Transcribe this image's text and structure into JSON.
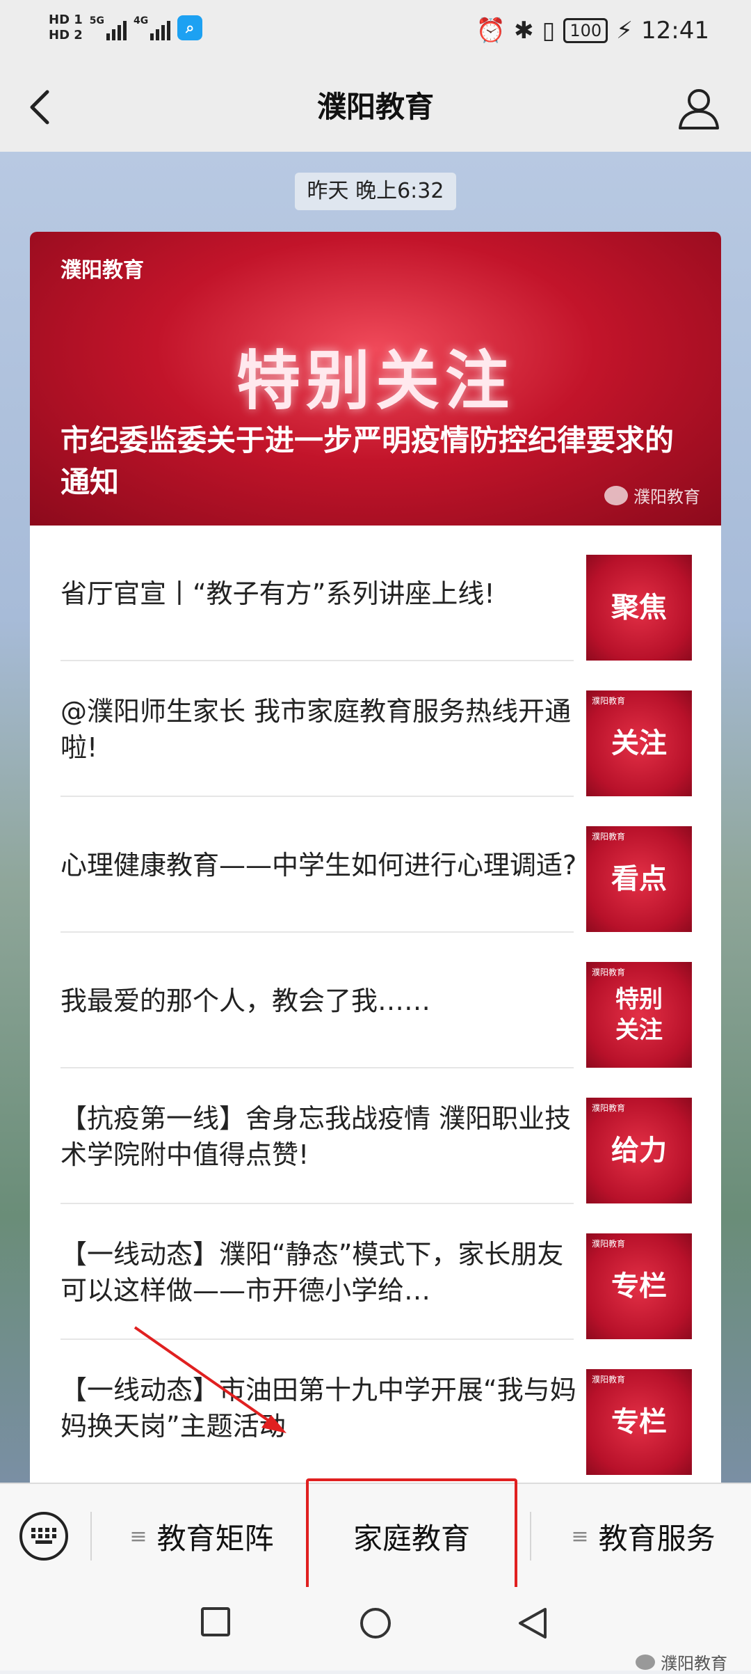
{
  "status_bar": {
    "hd1": "HD 1",
    "hd2": "HD 2",
    "net1": "5G",
    "net2": "4G",
    "battery": "100",
    "time": "12:41"
  },
  "nav": {
    "title": "濮阳教育"
  },
  "timestamp": "昨天 晚上6:32",
  "cover": {
    "brand": "濮阳教育",
    "banner": "特别关注",
    "title": "市纪委监委关于进一步严明疫情防控纪律要求的通知",
    "watermark": "濮阳教育"
  },
  "articles": [
    {
      "title": "省厅官宣丨“教子有方”系列讲座上线!",
      "thumb": "聚焦"
    },
    {
      "title": "@濮阳师生家长  我市家庭教育服务热线开通啦!",
      "thumb": "关注"
    },
    {
      "title": "心理健康教育——中学生如何进行心理调适?",
      "thumb": "看点"
    },
    {
      "title": "我最爱的那个人，教会了我……",
      "thumb": "特别关注"
    },
    {
      "title": "【抗疫第一线】舍身忘我战疫情  濮阳职业技术学院附中值得点赞!",
      "thumb": "给力"
    },
    {
      "title": "【一线动态】濮阳“静态”模式下，家长朋友可以这样做——市开德小学给…",
      "thumb": "专栏"
    },
    {
      "title": "【一线动态】市油田第十九中学开展“我与妈妈换天岗”主题活动",
      "thumb": "专栏"
    }
  ],
  "thumb_brand": "濮阳教育",
  "menu": {
    "items": [
      "教育矩阵",
      "家庭教育",
      "教育服务"
    ]
  },
  "footer_watermark": "濮阳教育",
  "colors": {
    "accent_red": "#c2142a",
    "highlight": "#e02020"
  }
}
